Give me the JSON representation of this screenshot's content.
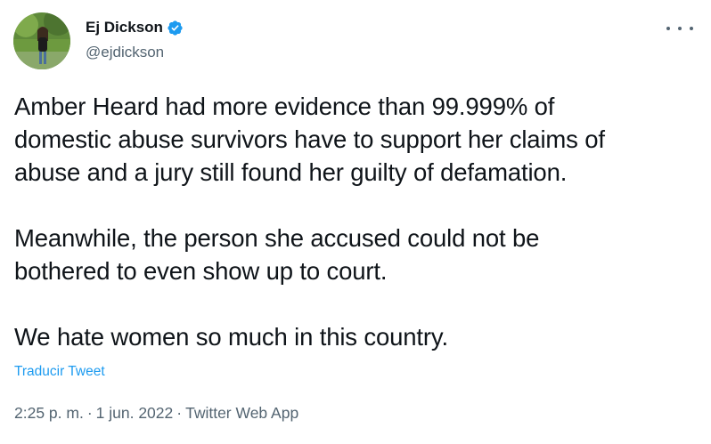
{
  "author": {
    "display_name": "Ej Dickson",
    "handle": "@ejdickson",
    "verified": true,
    "verified_icon": "verified-badge-icon",
    "avatar_icon": "avatar-photo"
  },
  "tweet": {
    "paragraphs": [
      "Amber Heard had more evidence than 99.999% of\ndomestic abuse survivors have to support her claims of\nabuse and a jury still found her guilty of defamation.",
      "Meanwhile, the person she accused could not be\nbothered to even show up to court.",
      "We hate women so much in this country."
    ],
    "translate_label": "Traducir Tweet",
    "time": "2:25 p. m.",
    "date": "1 jun. 2022",
    "source": "Twitter Web App",
    "separator": "·"
  },
  "menu": {
    "more_icon": "more-options-icon"
  },
  "colors": {
    "accent": "#1d9bf0",
    "text_primary": "#0f1419",
    "text_secondary": "#536471"
  }
}
